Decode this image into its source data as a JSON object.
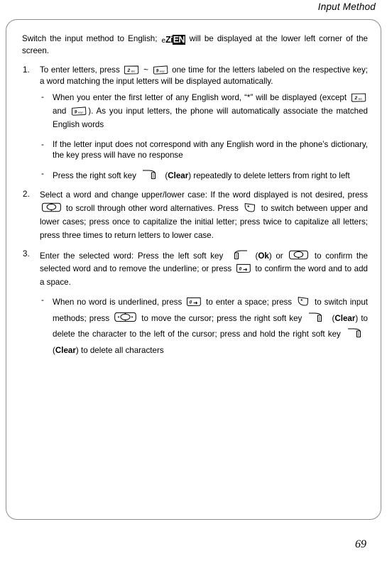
{
  "header": {
    "running_title": "Input Method"
  },
  "page": {
    "number": "69"
  },
  "status_indicator": {
    "name": "eZiEN",
    "part_e": "e",
    "part_zi": "Zi",
    "part_en": "EN"
  },
  "lead_paragraph": {
    "before_icon": "Switch the input method to English; ",
    "after_icon": " will be displayed at the lower left corner of the screen."
  },
  "steps": [
    {
      "number": "1.",
      "segments": {
        "s1": "To enter letters, press ",
        "s2": " ~ ",
        "s3": " one time for the letters labeled on the respective key; a word matching the input letters will be displayed automatically."
      },
      "subs": [
        {
          "s1": "When you enter the first letter of any English word, “*” will be displayed (except ",
          "s2": " and ",
          "s3": "). As you input letters, the phone will automatically associate the matched English words"
        },
        {
          "s1": "If the letter input does not correspond with any English word in the phone’s dictionary, the key press will have no response"
        },
        {
          "s1": "Press the right soft key ",
          "s2": " (",
          "bold": "Clear",
          "s3": ") repeatedly to delete letters from right to left"
        }
      ]
    },
    {
      "number": "2.",
      "segments": {
        "s1": "Select a word and change upper/lower case: If the word displayed is not desired, press ",
        "s2": " to scroll through other word alternatives. Press ",
        "s3": " to switch between upper and lower cases; press once to capitalize the initial letter; press twice to capitalize all letters; press three times to return letters to lower case."
      },
      "subs": []
    },
    {
      "number": "3.",
      "segments": {
        "s1": "Enter the selected word: Press the left soft key ",
        "s2": " (",
        "bold_ok": "Ok",
        "s3": ") or ",
        "s4": " to confirm the selected word and to remove the underline; or press ",
        "s5": " to confirm the word and to add a space."
      },
      "subs": [
        {
          "s1": "When no word is underlined, press ",
          "s2": " to enter a space; press ",
          "s3": " to switch input methods; press ",
          "s4": " to move the cursor; press the right soft key ",
          "s5": " (",
          "bold1": "Clear",
          "s6": ") to delete the character to the left of the cursor; press and hold the right soft key ",
          "s7": " (",
          "bold2": "Clear",
          "s8": ") to delete all characters"
        }
      ]
    }
  ],
  "key_icons": {
    "key2": {
      "label": "2",
      "sub": "abc"
    },
    "key9": {
      "label": "9",
      "sub": "wxyz"
    },
    "key0": {
      "label": "0",
      "sub": "space"
    },
    "keystar": {
      "label": "*"
    },
    "soft_right": {
      "label": "right-soft-key"
    },
    "soft_left": {
      "label": "left-soft-key"
    },
    "nav_updown": {
      "label": "up-down-navigation-key"
    },
    "nav_4way": {
      "label": "four-way-navigation-key"
    }
  },
  "colors": {
    "frame_border": "#8c8c8c",
    "text": "#000000",
    "background": "#ffffff"
  }
}
